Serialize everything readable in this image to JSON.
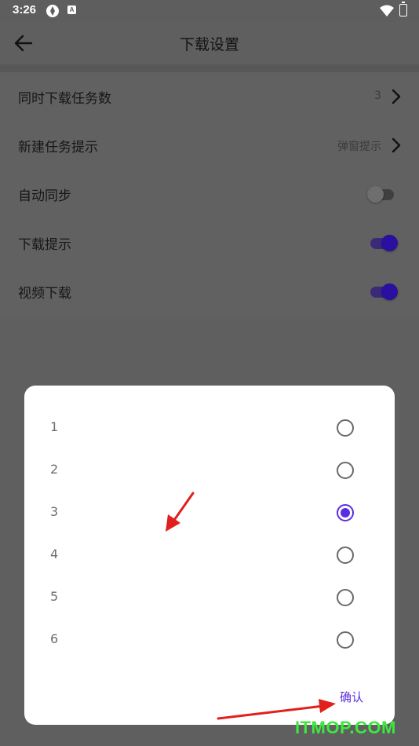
{
  "status": {
    "time": "3:26",
    "badge": "A"
  },
  "appbar": {
    "title": "下载设置"
  },
  "settings": [
    {
      "label": "同时下载任务数",
      "value": "3",
      "type": "nav"
    },
    {
      "label": "新建任务提示",
      "value": "弹窗提示",
      "type": "nav"
    },
    {
      "label": "自动同步",
      "type": "toggle",
      "on": false
    },
    {
      "label": "下载提示",
      "type": "toggle",
      "on": true
    },
    {
      "label": "视频下载",
      "type": "toggle",
      "on": true
    }
  ],
  "dialog": {
    "options": [
      "1",
      "2",
      "3",
      "4",
      "5",
      "6"
    ],
    "selected": "3",
    "confirm_label": "确认"
  },
  "watermark": "ITMOP.COM",
  "colors": {
    "accent": "#5a2ee0",
    "annotation": "#e0201c",
    "watermark": "#3fe73f"
  }
}
